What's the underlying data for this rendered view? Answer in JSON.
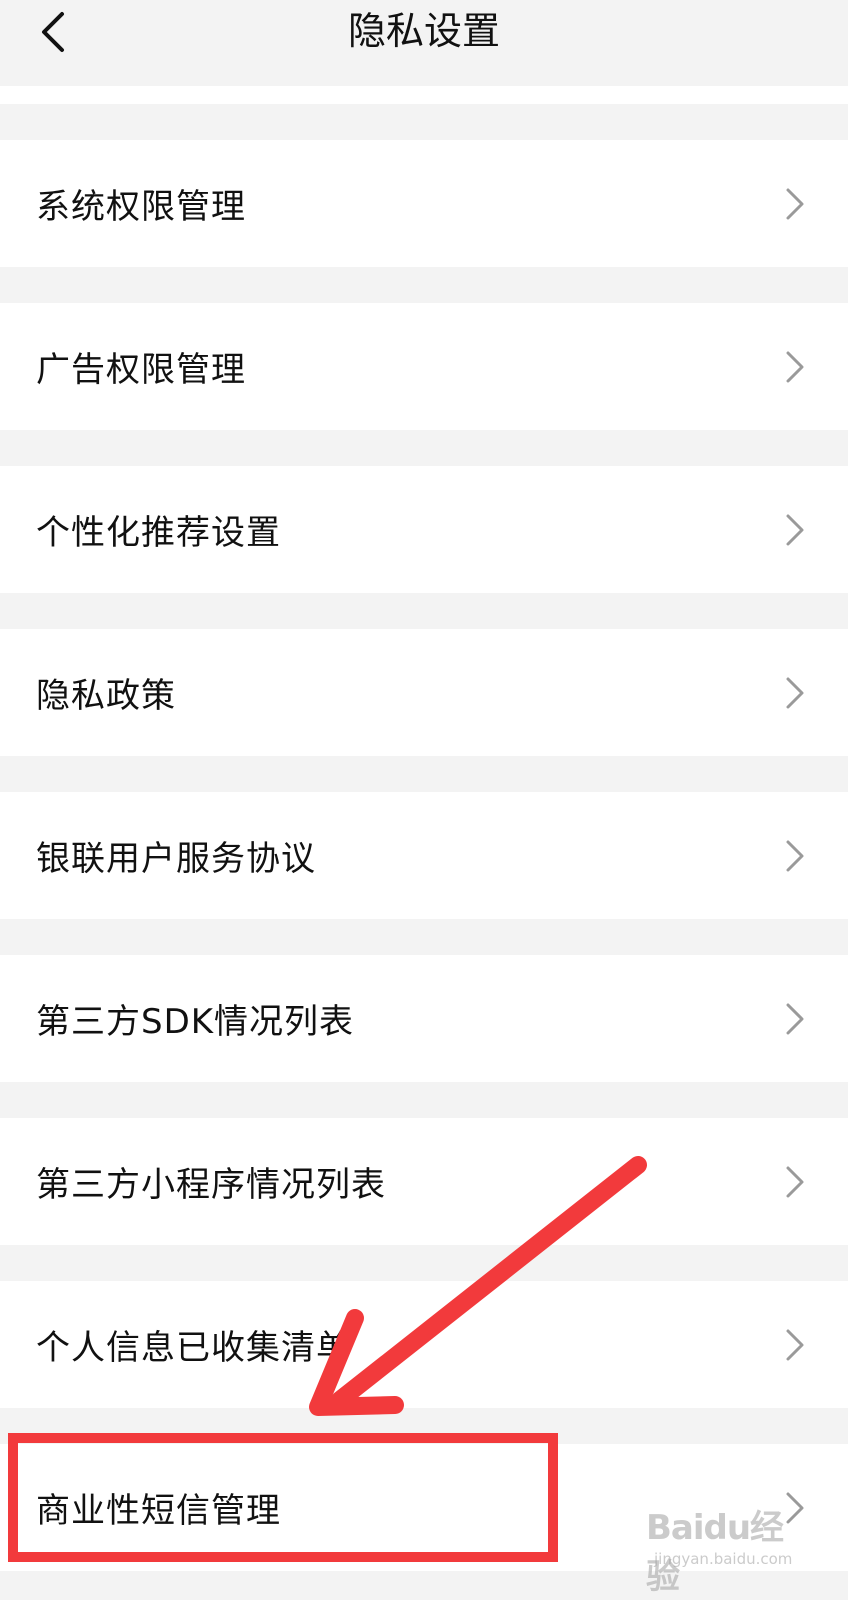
{
  "header": {
    "title": "隐私设置"
  },
  "menu": [
    {
      "label": "系统权限管理"
    },
    {
      "label": "广告权限管理"
    },
    {
      "label": "个性化推荐设置"
    },
    {
      "label": "隐私政策"
    },
    {
      "label": "银联用户服务协议"
    },
    {
      "label": "第三方SDK情况列表"
    },
    {
      "label": "第三方小程序情况列表"
    },
    {
      "label": "个人信息已收集清单"
    },
    {
      "label": "商业性短信管理"
    }
  ],
  "annotation": {
    "color": "#f23a3c"
  },
  "watermark": {
    "brand": "Baidu经验",
    "url": "jingyan.baidu.com"
  }
}
